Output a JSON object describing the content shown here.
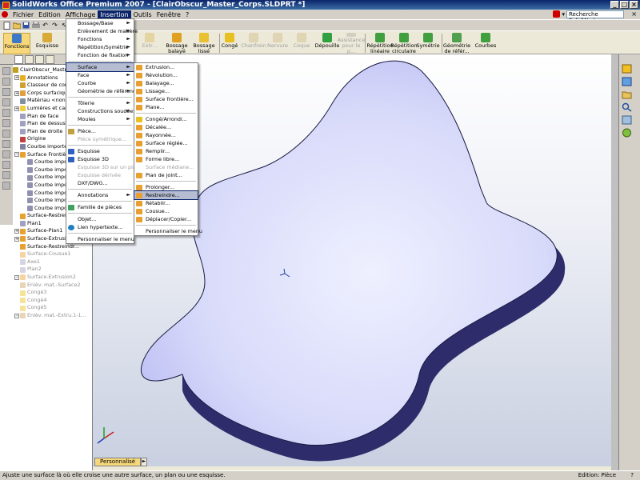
{
  "window": {
    "title": "SolidWorks Office Premium 2007 - [ClairObscur_Master_Corps.SLDPRT *]",
    "controls": [
      "_",
      "□",
      "×"
    ]
  },
  "menubar": {
    "items": [
      "Fichier",
      "Edition",
      "Affichage",
      "Insertion",
      "Outils",
      "Fenêtre",
      "?"
    ],
    "search_placeholder": "Recherche SolidWorks",
    "close": "×"
  },
  "cmdbar": {
    "buttons": [
      {
        "label": "Fonctions"
      },
      {
        "label": "Esquisse"
      },
      {
        "label": "Extr..."
      },
      {
        "label": "Enlèv. ma..."
      },
      {
        "label": "Bossage balayé"
      },
      {
        "label": "Bossage lissé"
      },
      {
        "label": "Congé"
      },
      {
        "label": "Chanfrein"
      },
      {
        "label": "Nervure"
      },
      {
        "label": "Coque"
      },
      {
        "label": "Dépouille"
      },
      {
        "label": "Assistance pour le p..."
      },
      {
        "label": "Répétition linéaire"
      },
      {
        "label": "Répétition circulaire"
      },
      {
        "label": "Symétrie"
      },
      {
        "label": "Géométrie de référ..."
      },
      {
        "label": "Courbes"
      }
    ]
  },
  "tree": {
    "items": [
      {
        "label": "ClairObscur_Master_Co..."
      },
      {
        "label": "Annotations"
      },
      {
        "label": "Classeur de concep..."
      },
      {
        "label": "Corps surfaciques(..."
      },
      {
        "label": "Matériau <non spé..."
      },
      {
        "label": "Lumières et caméra..."
      },
      {
        "label": "Plan de face"
      },
      {
        "label": "Plan de dessus"
      },
      {
        "label": "Plan de droite"
      },
      {
        "label": "Origine"
      },
      {
        "label": "Courbe importée?"
      },
      {
        "label": "Surface Frontière1"
      },
      {
        "label": "Courbe importé..."
      },
      {
        "label": "Courbe importé..."
      },
      {
        "label": "Courbe importé..."
      },
      {
        "label": "Courbe importé..."
      },
      {
        "label": "Courbe importé..."
      },
      {
        "label": "Courbe importé..."
      },
      {
        "label": "Courbe importé..."
      },
      {
        "label": "Surface-Restreindr..."
      },
      {
        "label": "Plan1"
      },
      {
        "label": "Surface-Plan1"
      },
      {
        "label": "Surface-Extrusion1"
      },
      {
        "label": "Surface-Restreindr..."
      },
      {
        "label": "Surface-Cousue1"
      },
      {
        "label": "Axe1"
      },
      {
        "label": "Plan2"
      },
      {
        "label": "Surface-Extrusion2"
      },
      {
        "label": "Enlèv. mat.-Surface2"
      },
      {
        "label": "Congé3"
      },
      {
        "label": "Congé4"
      },
      {
        "label": "Congé5"
      },
      {
        "label": "Enlèv. mat.-Extru.1-1..."
      }
    ]
  },
  "insertion_menu": {
    "items": [
      {
        "label": "Bossage/Base",
        "arrow": "►"
      },
      {
        "label": "Enlèvement de matière",
        "arrow": "►"
      },
      {
        "label": "Fonctions",
        "arrow": "►"
      },
      {
        "label": "Répétition/Symétrie",
        "arrow": "►"
      },
      {
        "label": "Fonction de fixation",
        "arrow": "►"
      },
      {
        "label": "Surface",
        "arrow": "►"
      },
      {
        "label": "Face",
        "arrow": "►"
      },
      {
        "label": "Courbe",
        "arrow": "►"
      },
      {
        "label": "Géométrie de référence",
        "arrow": "►"
      },
      {
        "label": "Tôlerie",
        "arrow": "►"
      },
      {
        "label": "Constructions soudées",
        "arrow": "►"
      },
      {
        "label": "Moules",
        "arrow": "►"
      },
      {
        "label": "Pièce..."
      },
      {
        "label": "Pièce symétrique..."
      },
      {
        "label": "Esquisse"
      },
      {
        "label": "Esquisse 3D"
      },
      {
        "label": "Esquisse 3D sur un plan"
      },
      {
        "label": "Esquisse dérivée"
      },
      {
        "label": "DXF/DWG..."
      },
      {
        "label": "Annotations",
        "arrow": "►"
      },
      {
        "label": "Famille de pièces"
      },
      {
        "label": "Objet..."
      },
      {
        "label": "Lien hypertexte..."
      },
      {
        "label": "Personnaliser le menu"
      }
    ]
  },
  "surface_submenu": {
    "items": [
      {
        "label": "Extrusion..."
      },
      {
        "label": "Révolution..."
      },
      {
        "label": "Balayage..."
      },
      {
        "label": "Lissage..."
      },
      {
        "label": "Surface frontière..."
      },
      {
        "label": "Plane..."
      },
      {
        "label": "Congé/Arrondi..."
      },
      {
        "label": "Décalée..."
      },
      {
        "label": "Rayonnée..."
      },
      {
        "label": "Surface réglée..."
      },
      {
        "label": "Remplir..."
      },
      {
        "label": "Forme libre..."
      },
      {
        "label": "Surface médiane..."
      },
      {
        "label": "Plan de joint..."
      },
      {
        "label": "Prolonger..."
      },
      {
        "label": "Restreindre..."
      },
      {
        "label": "Rétablir..."
      },
      {
        "label": "Cousue..."
      },
      {
        "label": "Déplacer/Copier..."
      },
      {
        "label": "Personnaliser le menu"
      }
    ]
  },
  "view_tabs": {
    "active": "Personnalisé",
    "more": "►"
  },
  "statusbar": {
    "message": "Ajuste une surface là où elle croise une autre surface, un plan ou une esquisse.",
    "mode": "Edition: Pièce",
    "help": "?"
  },
  "colors": {
    "titlebar": "#0a246a",
    "model_top": "#d8dafa",
    "model_side": "#2e2c6b",
    "menu_highlight": "#b6bdd2",
    "active_tab": "#f6d77a"
  }
}
